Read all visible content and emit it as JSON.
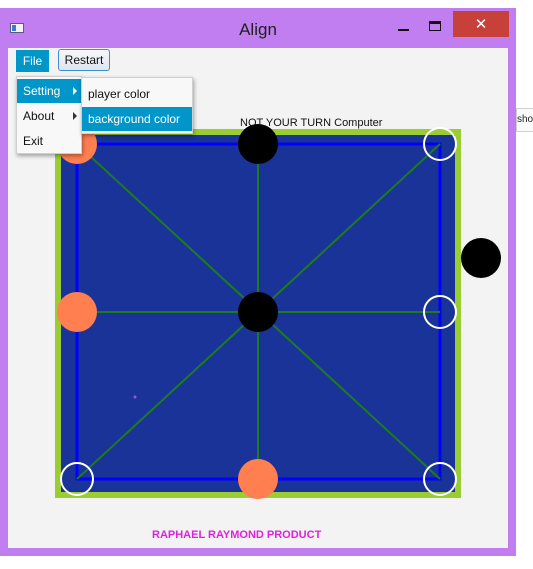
{
  "window": {
    "title": "Align",
    "close_glyph": "✕",
    "icons": {
      "app": "app-window-icon",
      "minimize": "minimize-icon",
      "maximize": "maximize-icon",
      "close": "close-icon"
    }
  },
  "menubar": {
    "file_label": "File",
    "restart_label": "Restart"
  },
  "file_menu": {
    "items": [
      {
        "label": "Setting",
        "has_submenu": true,
        "highlighted": true
      },
      {
        "label": "About",
        "has_submenu": true,
        "highlighted": false
      },
      {
        "label": "Exit",
        "has_submenu": false,
        "highlighted": false
      }
    ]
  },
  "setting_submenu": {
    "items": [
      {
        "label": "player color",
        "highlighted": false
      },
      {
        "label": "background color",
        "highlighted": true
      }
    ]
  },
  "game": {
    "status": "NOT  YOUR TURN Computer",
    "footer": "RAPHAEL RAYMOND PRODUCT",
    "colors": {
      "board_fill": "#1a3399",
      "board_border": "#9acd32",
      "outer_lines": "#0000ff",
      "diagonal_lines": "#1e7b1e",
      "player_piece": "#ff7f50",
      "computer_piece": "#000000",
      "empty_spot": "#ffffff",
      "footer_text": "#e020e0",
      "menu_highlight": "#0096c9"
    },
    "board_pieces": [
      {
        "row": 0,
        "col": 0,
        "owner": "player"
      },
      {
        "row": 0,
        "col": 1,
        "owner": "computer"
      },
      {
        "row": 0,
        "col": 2,
        "owner": "empty"
      },
      {
        "row": 1,
        "col": 0,
        "owner": "player"
      },
      {
        "row": 1,
        "col": 1,
        "owner": "computer"
      },
      {
        "row": 1,
        "col": 2,
        "owner": "empty"
      },
      {
        "row": 2,
        "col": 0,
        "owner": "empty"
      },
      {
        "row": 2,
        "col": 1,
        "owner": "player"
      },
      {
        "row": 2,
        "col": 2,
        "owner": "empty"
      }
    ],
    "off_board_pieces": [
      {
        "owner": "computer"
      }
    ]
  },
  "side_sliver_text": "sho"
}
